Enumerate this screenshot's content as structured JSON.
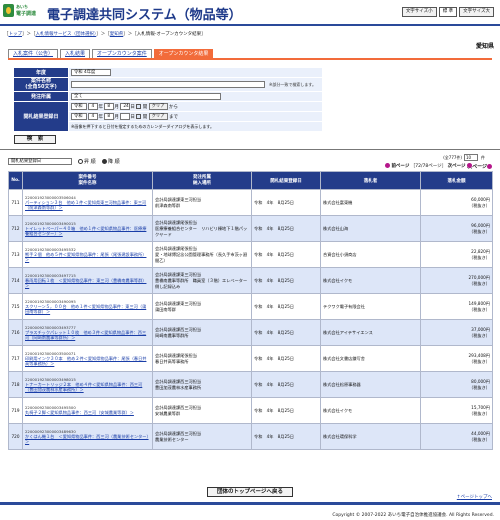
{
  "header": {
    "logo_top": "あいち",
    "logo_bottom": "電子調達",
    "title": "電子調達共同システム（物品等）",
    "font_small": "文字サイズ小",
    "font_standard": "標 準",
    "font_large": "文字サイズ大"
  },
  "breadcrumb": {
    "top": "トップ",
    "service": "入札情報サービス（団体選択）",
    "org": "愛知県",
    "current": "入札情報-オープンカウンタ結果"
  },
  "org_name": "愛知県",
  "tabs": [
    "入札案件（公告）",
    "入札結果",
    "オープンカウンタ案件",
    "オープンカウンタ結果"
  ],
  "search": {
    "fiscal_year_label": "年度",
    "fiscal_year_value": "令和 4年度",
    "item_name_label": "案件名称\n(全角50文字)",
    "item_name_note": "※部分一致で検索します。",
    "department_label": "発注所属",
    "department_value": "全て",
    "date_label": "開札結果登録日",
    "date_from": {
      "era": "令和",
      "year": "4",
      "month": "8",
      "day": "24",
      "open": "開",
      "clear": "クリア",
      "suffix": "から"
    },
    "date_to": {
      "era": "令和",
      "year": "4",
      "month": "8",
      "day": "",
      "open": "開",
      "clear": "クリア",
      "suffix": "まで"
    },
    "date_note": "※画像を押下すると日付を指定するためのカレンダーダイアログを表示します。",
    "search_button": "検　索"
  },
  "controls": {
    "sort_value": "開札結果登録日",
    "radio_asc": "昇 順",
    "radio_desc": "降 順",
    "count_text": "(全777件)",
    "per_page": "10",
    "per_page_unit": "件",
    "next_top": "次ページ",
    "prev": "前ページ",
    "page_info": "72/78ページ",
    "next": "次ページ"
  },
  "table": {
    "headers": {
      "no": "No.",
      "item": "案件番号\n案件名称",
      "dept": "発注所属\n納入場所",
      "date": "開札結果登録日",
      "winner": "落札者",
      "amount": "落札金額"
    },
    "rows": [
      {
        "no": "711",
        "id": "220001923000003506044",
        "name": "パーティション３台　他め１件＜愛知県東三河物品事件：東三河（前津森南等群）＞",
        "dept": "会計局調達課東三河担当",
        "place": "前津森南等群",
        "date": "令和　4年　8月25日",
        "winner": "株式会社富東機",
        "amount": "60,000円",
        "tax": "（税抜き）"
      },
      {
        "no": "712",
        "id": "220001923000003490015",
        "name": "トイレットペーパー４０箱　他め１件＜愛知県物品事件：医療療養組合センター）＞",
        "dept": "会計局調達課尾張担当",
        "place": "医療療養組合センター　リハビリ棟地下１階パックヤード",
        "date": "令和　4年　8月25日",
        "winner": "株式会社山海",
        "amount": "96,000円",
        "tax": "（税抜き）"
      },
      {
        "no": "713",
        "id": "220001923000003495532",
        "name": "熊手２個　他め５件＜愛知県物品事件：尾張（尾張建設事務所）＞",
        "dept": "会計局調達課尾張担当",
        "place": "愛・地球博記念公園管理事務所（長久手市茨ヶ廻間乙）",
        "date": "令和　4年　8月25日",
        "winner": "合資会社小須商店",
        "amount": "22,820円",
        "tax": "（税抜き）"
      },
      {
        "no": "714",
        "id": "220001923000003497715",
        "name": "春雨用回転１枚　＜愛知県物品事件：東三河（豊橋南農事等群）＞",
        "dept": "会計局調達課東三河担当",
        "place": "豊橋南農事等群所　職員室（３階）エレベーター側し記録込み",
        "date": "令和　4年　8月25日",
        "winner": "株式会社イクモ",
        "amount": "270,000円",
        "tax": "（税抜き）"
      },
      {
        "no": "715",
        "id": "220001923000003490095",
        "name": "スクリーン５，００台　他め１件＜愛知県物品事件：東三河（蒲田南等群）＞",
        "dept": "会計局調達課東三河担当",
        "place": "蒲田南等群",
        "date": "令和　4年　8月25日",
        "winner": "テクワク電子有限会社",
        "amount": "149,800円",
        "tax": "（税抜き）"
      },
      {
        "no": "716",
        "id": "220000923000003493777",
        "name": "プラスチックパレット１０枚　他め３件＜愛知県物品事件：西三河（岡崎南農事等群所）＞",
        "dept": "会計局調達課西三河担当",
        "place": "岡崎南農事等群所",
        "date": "令和　4年　8月25日",
        "winner": "株式会社アイテサイエンス",
        "amount": "37,000円",
        "tax": "（税抜き）"
      },
      {
        "no": "717",
        "id": "220001923000003500071",
        "name": "印刷用インク３０本　他め２件＜愛知県物品事件：尾張（春日井高等事務所）＞",
        "dept": "会計局調達課尾張担当",
        "place": "春日井高等事務所",
        "date": "令和　4年　8月25日",
        "winner": "株式会社文書店鎌写舎",
        "amount": "293,408円",
        "tax": "（税抜き）"
      },
      {
        "no": "718",
        "id": "220001923000003498015",
        "name": "トナーカートリッジ２本　他め４件＜愛知県物品事件：西三河（豊田加茂農林水産事務所）＞",
        "dept": "会計局調達課西三河担当",
        "place": "豊田加茂農林水産事務所",
        "date": "令和　4年　8月25日",
        "winner": "株式会社松原事務器",
        "amount": "80,000円",
        "tax": "（税抜き）"
      },
      {
        "no": "719",
        "id": "220000923000003495500",
        "name": "丸椅子２脚＜愛知県物品事件：西三河（安城農業等群）＞",
        "dept": "会計局調達課西三河担当",
        "place": "安城農業等群",
        "date": "令和　4年　8月25日",
        "winner": "株式会社イクモ",
        "amount": "15,700円",
        "tax": "（税抜き）"
      },
      {
        "no": "720",
        "id": "220000923000003489630",
        "name": "かくはん機１台　＜愛知県物品事件：西三河（農業技術センター）＞",
        "dept": "会計局調達課西三河担当",
        "place": "農業技術センター",
        "date": "令和　4年　8月25日",
        "winner": "株式会社環保科学",
        "amount": "44,000円",
        "tax": "（税抜き）"
      }
    ]
  },
  "footer": {
    "back_button": "団体のトップページへ戻る",
    "top_link": "ページトップへ",
    "copyright": "Copyright © 2007-2022 あいち電子自治体推進協議会. All Rights Reserved."
  }
}
